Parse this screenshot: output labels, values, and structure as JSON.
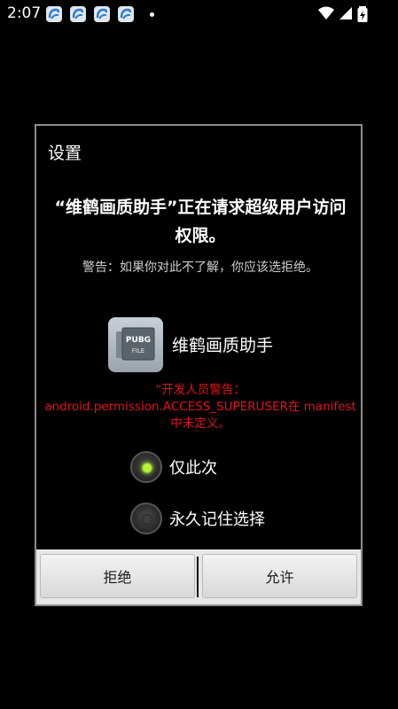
{
  "status_bar": {
    "time": "2:07",
    "icons": [
      "app-notification-icon",
      "app-notification-icon",
      "app-notification-icon",
      "app-notification-icon",
      "wifi-icon",
      "signal-icon",
      "battery-charging-icon"
    ]
  },
  "dialog": {
    "title": "设置",
    "headline": "“维鹤画质助手”正在请求超级用户访问权限。",
    "warning": "警告：如果你对此不了解，你应该选拒绝。",
    "app": {
      "name": "维鹤画质助手",
      "icon_text_top": "PUBG",
      "icon_text_bottom": "FILE"
    },
    "developer_warning": "“开发人员警告：android.permission.ACCESS_SUPERUSER在 manifest 中未定义。",
    "options": [
      {
        "label": "仅此次",
        "checked": true
      },
      {
        "label": "永久记住选择",
        "checked": false
      }
    ],
    "buttons": {
      "deny": "拒绝",
      "allow": "允许"
    }
  }
}
